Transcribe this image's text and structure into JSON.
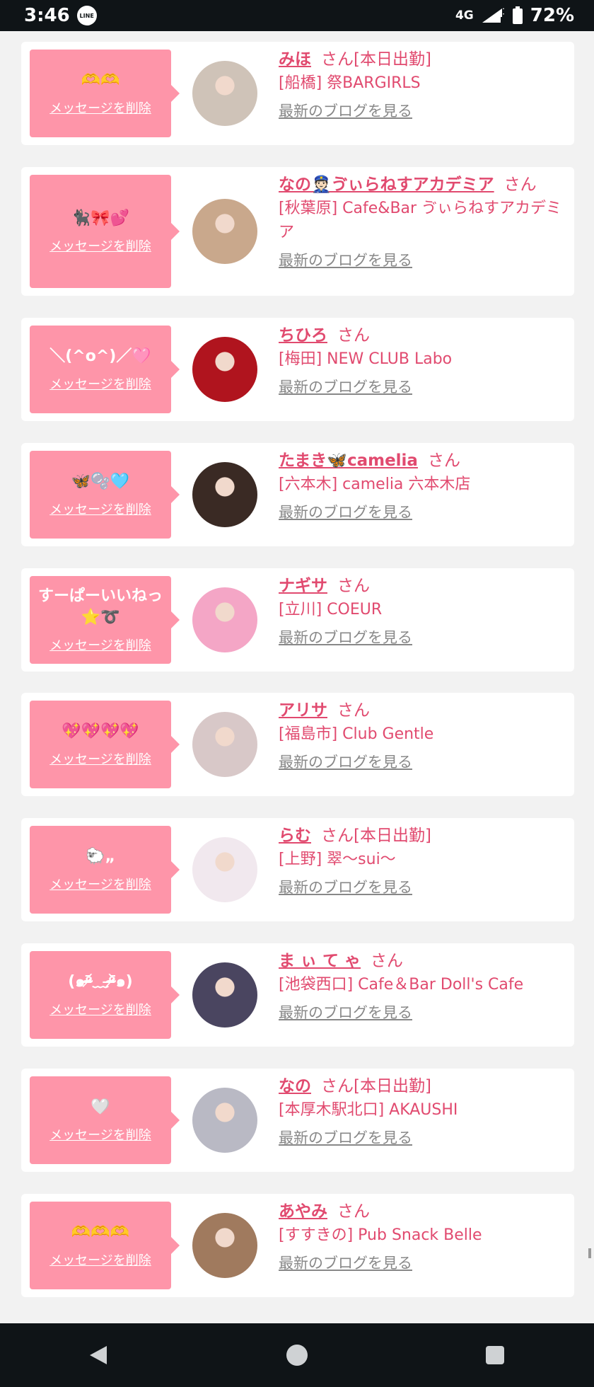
{
  "status": {
    "time": "3:46",
    "line_badge": "LINE",
    "network": "4G",
    "battery": "72%"
  },
  "colors": {
    "accent_pink": "#fe95a9",
    "name_pink": "#e14a6f",
    "blog_gray": "#888888"
  },
  "entries": [
    {
      "message": "🫶🫶",
      "delete_label": "メッセージを削除",
      "name": "みほ",
      "suffix": "さん[本日出勤]",
      "shop": "[船橋] 祭BARGIRLS",
      "blog_label": "最新のブログを見る",
      "avatar_color": "#cfc3b8"
    },
    {
      "message": "🐈‍⬛🎀💕",
      "delete_label": "メッセージを削除",
      "name": "なの👮🏻ゔぃらねすアカデミア",
      "suffix": "さん",
      "shop": "[秋葉原] Cafe&Bar ゔぃらねすアカデミア",
      "blog_label": "最新のブログを見る",
      "avatar_color": "#c9a88c"
    },
    {
      "message": "＼(^o^)／🩷",
      "delete_label": "メッセージを削除",
      "name": "ちひろ",
      "suffix": "さん",
      "shop": "[梅田] NEW CLUB Labo",
      "blog_label": "最新のブログを見る",
      "avatar_color": "#b0141e"
    },
    {
      "message": "🦋🫧🩵",
      "delete_label": "メッセージを削除",
      "name": "たまき🦋camelia",
      "suffix": "さん",
      "shop": "[六本木] camelia 六本木店",
      "blog_label": "最新のブログを見る",
      "avatar_color": "#3a2a24"
    },
    {
      "message": "すーぱーいいねっ⭐️➰",
      "delete_label": "メッセージを削除",
      "name": "ナギサ",
      "suffix": "さん",
      "shop": "[立川] COEUR",
      "blog_label": "最新のブログを見る",
      "avatar_color": "#f4a6c6"
    },
    {
      "message": "💖💖💖💖",
      "delete_label": "メッセージを削除",
      "name": "アリサ",
      "suffix": "さん",
      "shop": "[福島市] Club Gentle",
      "blog_label": "最新のブログを見る",
      "avatar_color": "#d8c8c8"
    },
    {
      "message": "🐑„",
      "delete_label": "メッセージを削除",
      "name": "らむ",
      "suffix": "さん[本日出勤]",
      "shop": "[上野] 翠〜sui〜",
      "blog_label": "最新のブログを見る",
      "avatar_color": "#f1e8ee"
    },
    {
      "message": "(๑ᵒ̴̶̷᷄﹏ᵒ̴̶̷᷅๑)",
      "delete_label": "メッセージを削除",
      "name": "ま ぃ て ゃ",
      "suffix": "さん",
      "shop": "[池袋西口] Cafe＆Bar Doll's Cafe",
      "blog_label": "最新のブログを見る",
      "avatar_color": "#4a4560"
    },
    {
      "message": "🤍",
      "delete_label": "メッセージを削除",
      "name": "なの",
      "suffix": "さん[本日出勤]",
      "shop": "[本厚木駅北口] AKAUSHI",
      "blog_label": "最新のブログを見る",
      "avatar_color": "#b9b9c4"
    },
    {
      "message": "🫶🫶🫶",
      "delete_label": "メッセージを削除",
      "name": "あやみ",
      "suffix": "さん",
      "shop": "[すすきの] Pub Snack Belle",
      "blog_label": "最新のブログを見る",
      "avatar_color": "#a07a5e"
    }
  ],
  "nav": {
    "back": "back-icon",
    "home": "home-icon",
    "recents": "recents-icon"
  }
}
